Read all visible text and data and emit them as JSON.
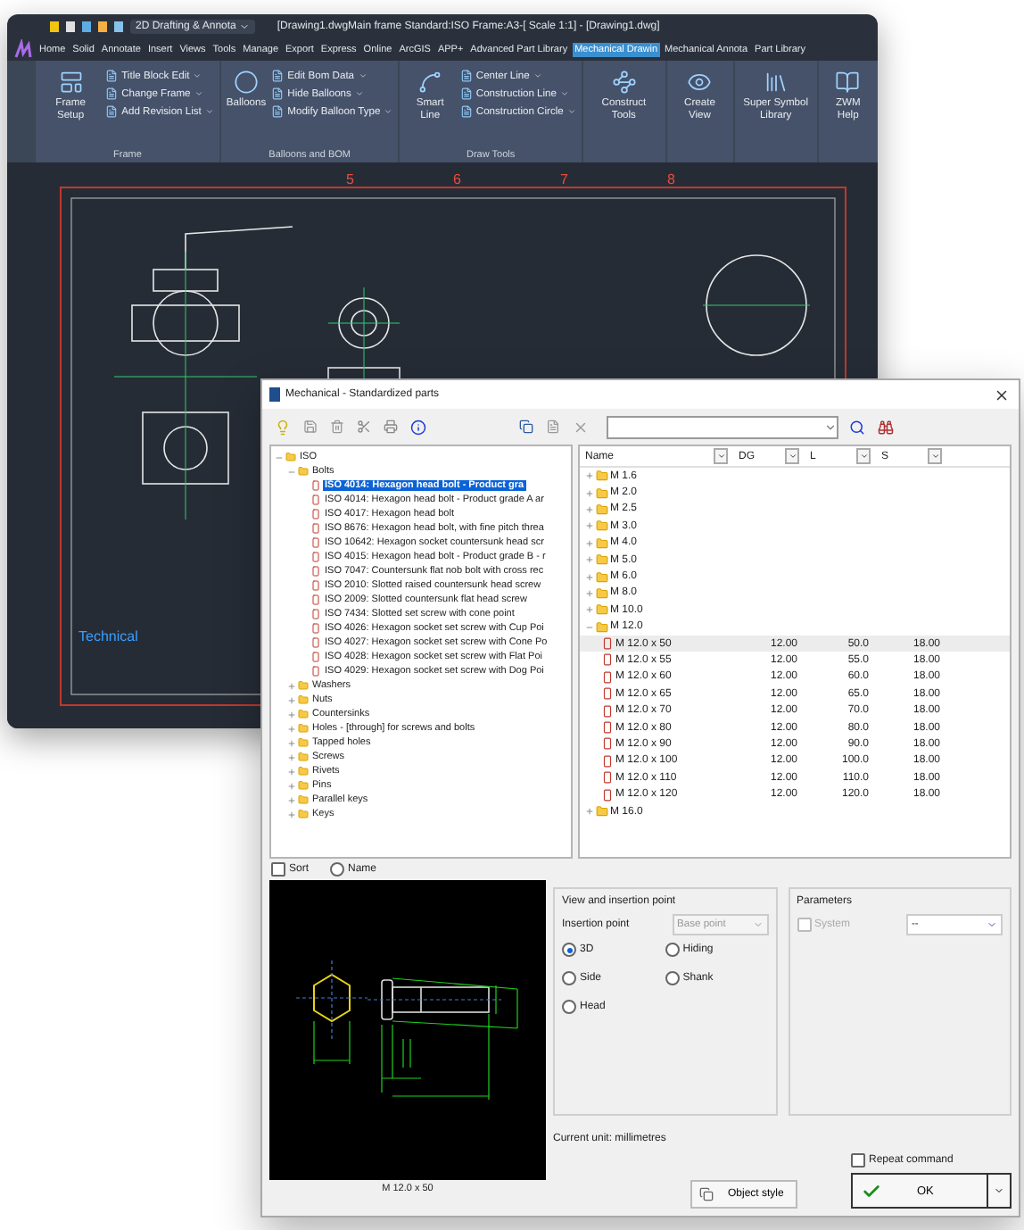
{
  "cad_window": {
    "workspace": "2D Drafting & Annota",
    "title": "[Drawing1.dwgMain frame Standard:ISO Frame:A3-[ Scale 1:1] - [Drawing1.dwg]",
    "ribbon_tabs": [
      {
        "label": "Home",
        "selected": false
      },
      {
        "label": "Solid",
        "selected": false
      },
      {
        "label": "Annotate",
        "selected": false
      },
      {
        "label": "Insert",
        "selected": false
      },
      {
        "label": "Views",
        "selected": false
      },
      {
        "label": "Tools",
        "selected": false
      },
      {
        "label": "Manage",
        "selected": false
      },
      {
        "label": "Export",
        "selected": false
      },
      {
        "label": "Express",
        "selected": false
      },
      {
        "label": "Online",
        "selected": false
      },
      {
        "label": "ArcGIS",
        "selected": false
      },
      {
        "label": "APP+",
        "selected": false
      },
      {
        "label": "Advanced Part Library",
        "selected": false
      },
      {
        "label": "Mechanical Drawin",
        "selected": true
      },
      {
        "label": "Mechanical Annota",
        "selected": false
      },
      {
        "label": "Part Library",
        "selected": false
      }
    ],
    "ribbon_groups": [
      {
        "label": "Frame",
        "tools": [
          {
            "label": "Frame Setup",
            "kind": "large"
          },
          {
            "label": "Title Block Edit",
            "kind": "small"
          },
          {
            "label": "Change Frame",
            "kind": "small"
          },
          {
            "label": "Add Revision List",
            "kind": "small"
          }
        ]
      },
      {
        "label": "Balloons and BOM",
        "tools": [
          {
            "label": "Balloons",
            "kind": "large"
          },
          {
            "label": "Edit Bom Data",
            "kind": "small"
          },
          {
            "label": "Hide Balloons",
            "kind": "small"
          },
          {
            "label": "Modify Balloon Type",
            "kind": "small"
          }
        ]
      },
      {
        "label": "Draw Tools",
        "tools": [
          {
            "label": "Smart Line",
            "kind": "large"
          },
          {
            "label": "Center Line",
            "kind": "small"
          },
          {
            "label": "Construction Line",
            "kind": "small"
          },
          {
            "label": "Construction Circle",
            "kind": "small"
          }
        ]
      },
      {
        "tools": [
          {
            "label": "Construct Tools",
            "kind": "large"
          }
        ]
      },
      {
        "tools": [
          {
            "label": "Create View",
            "kind": "large"
          }
        ]
      },
      {
        "tools": [
          {
            "label": "Super Symbol Library",
            "kind": "large"
          }
        ]
      },
      {
        "tools": [
          {
            "label": "ZWM Help",
            "kind": "large"
          }
        ]
      }
    ],
    "frame_labels": [
      "5",
      "6",
      "7",
      "8"
    ],
    "drawing_note": "Technical"
  },
  "dialog": {
    "title": "Mechanical - Standardized parts",
    "tree": [
      {
        "label": "ISO",
        "kind": "folder",
        "expanded": true,
        "selected": false,
        "children": [
          {
            "label": "Bolts",
            "kind": "folder",
            "expanded": true,
            "selected": false,
            "children": [
              {
                "label": "ISO 4014: Hexagon head bolt - Product gra",
                "kind": "part",
                "selected": true
              },
              {
                "label": "ISO 4014: Hexagon head bolt - Product grade A ar",
                "kind": "part",
                "selected": false
              },
              {
                "label": "ISO 4017: Hexagon head bolt",
                "kind": "part",
                "selected": false
              },
              {
                "label": "ISO 8676: Hexagon head bolt, with fine pitch threa",
                "kind": "part",
                "selected": false
              },
              {
                "label": "ISO 10642: Hexagon socket countersunk head scr",
                "kind": "part",
                "selected": false
              },
              {
                "label": "ISO 4015: Hexagon head bolt - Product grade B - r",
                "kind": "part",
                "selected": false
              },
              {
                "label": "ISO 7047: Countersunk flat nob bolt with cross rec",
                "kind": "part",
                "selected": false
              },
              {
                "label": "ISO 2010: Slotted raised countersunk head screw",
                "kind": "part",
                "selected": false
              },
              {
                "label": "ISO 2009: Slotted countersunk flat head screw",
                "kind": "part",
                "selected": false
              },
              {
                "label": "ISO 7434: Slotted set screw with cone point",
                "kind": "part",
                "selected": false
              },
              {
                "label": "ISO 4026: Hexagon socket set screw with Cup Poi",
                "kind": "part",
                "selected": false
              },
              {
                "label": "ISO 4027: Hexagon socket set screw with Cone Po",
                "kind": "part",
                "selected": false
              },
              {
                "label": "ISO 4028: Hexagon socket set screw with Flat Poi",
                "kind": "part",
                "selected": false
              },
              {
                "label": "ISO 4029: Hexagon socket set screw with Dog Poi",
                "kind": "part",
                "selected": false
              }
            ]
          },
          {
            "label": "Washers",
            "kind": "folder",
            "expanded": false,
            "selected": false
          },
          {
            "label": "Nuts",
            "kind": "folder",
            "expanded": false,
            "selected": false
          },
          {
            "label": "Countersinks",
            "kind": "folder",
            "expanded": false,
            "selected": false
          },
          {
            "label": "Holes - [through] for screws and bolts",
            "kind": "folder",
            "expanded": false,
            "selected": false
          },
          {
            "label": "Tapped holes",
            "kind": "folder",
            "expanded": false,
            "selected": false
          },
          {
            "label": "Screws",
            "kind": "folder",
            "expanded": false,
            "selected": false
          },
          {
            "label": "Rivets",
            "kind": "folder",
            "expanded": false,
            "selected": false
          },
          {
            "label": "Pins",
            "kind": "folder",
            "expanded": false,
            "selected": false
          },
          {
            "label": "Parallel keys",
            "kind": "folder",
            "expanded": false,
            "selected": false
          },
          {
            "label": "Keys",
            "kind": "folder",
            "expanded": false,
            "selected": false
          }
        ]
      }
    ],
    "columns": [
      "Name",
      "DG",
      "L",
      "S"
    ],
    "rows": [
      {
        "name": "M 1.6",
        "kind": "folder",
        "expanded": false,
        "selected": false
      },
      {
        "name": "M 2.0",
        "kind": "folder",
        "expanded": false,
        "selected": false
      },
      {
        "name": "M 2.5",
        "kind": "folder",
        "expanded": false,
        "selected": false
      },
      {
        "name": "M 3.0",
        "kind": "folder",
        "expanded": false,
        "selected": false
      },
      {
        "name": "M 4.0",
        "kind": "folder",
        "expanded": false,
        "selected": false
      },
      {
        "name": "M 5.0",
        "kind": "folder",
        "expanded": false,
        "selected": false
      },
      {
        "name": "M 6.0",
        "kind": "folder",
        "expanded": false,
        "selected": false
      },
      {
        "name": "M 8.0",
        "kind": "folder",
        "expanded": false,
        "selected": false
      },
      {
        "name": "M 10.0",
        "kind": "folder",
        "expanded": false,
        "selected": false
      },
      {
        "name": "M 12.0",
        "kind": "folder",
        "expanded": true,
        "selected": false,
        "children": [
          {
            "name": "M 12.0 x 50",
            "kind": "part",
            "selected": true,
            "dg": "12.00",
            "l": "50.0",
            "s": "18.00"
          },
          {
            "name": "M 12.0 x 55",
            "kind": "part",
            "selected": false,
            "dg": "12.00",
            "l": "55.0",
            "s": "18.00"
          },
          {
            "name": "M 12.0 x 60",
            "kind": "part",
            "selected": false,
            "dg": "12.00",
            "l": "60.0",
            "s": "18.00"
          },
          {
            "name": "M 12.0 x 65",
            "kind": "part",
            "selected": false,
            "dg": "12.00",
            "l": "65.0",
            "s": "18.00"
          },
          {
            "name": "M 12.0 x 70",
            "kind": "part",
            "selected": false,
            "dg": "12.00",
            "l": "70.0",
            "s": "18.00"
          },
          {
            "name": "M 12.0 x 80",
            "kind": "part",
            "selected": false,
            "dg": "12.00",
            "l": "80.0",
            "s": "18.00"
          },
          {
            "name": "M 12.0 x 90",
            "kind": "part",
            "selected": false,
            "dg": "12.00",
            "l": "90.0",
            "s": "18.00"
          },
          {
            "name": "M 12.0 x 100",
            "kind": "part",
            "selected": false,
            "dg": "12.00",
            "l": "100.0",
            "s": "18.00"
          },
          {
            "name": "M 12.0 x 110",
            "kind": "part",
            "selected": false,
            "dg": "12.00",
            "l": "110.0",
            "s": "18.00"
          },
          {
            "name": "M 12.0 x 120",
            "kind": "part",
            "selected": false,
            "dg": "12.00",
            "l": "120.0",
            "s": "18.00"
          }
        ]
      },
      {
        "name": "M 16.0",
        "kind": "folder",
        "expanded": false,
        "selected": false
      }
    ],
    "sort": {
      "label": "Sort",
      "checked": false
    },
    "name_option": {
      "label": "Name",
      "selected": false
    },
    "preview_caption": "M 12.0 x 50",
    "view_group": {
      "title": "View and insertion point",
      "insertion_label": "Insertion point",
      "base_point": {
        "value": "Base point",
        "disabled": true
      },
      "options": [
        {
          "label": "3D",
          "selected": true
        },
        {
          "label": "Hiding",
          "selected": false
        },
        {
          "label": "Side",
          "selected": false
        },
        {
          "label": "Shank",
          "selected": false
        },
        {
          "label": "Head",
          "selected": false
        }
      ]
    },
    "parameters": {
      "title": "Parameters",
      "system": {
        "label": "System",
        "checked": false,
        "disabled": true
      },
      "value": "--"
    },
    "unit": "Current unit: millimetres",
    "object_style": "Object style",
    "repeat": {
      "label": "Repeat command",
      "checked": false
    },
    "ok": "OK"
  }
}
